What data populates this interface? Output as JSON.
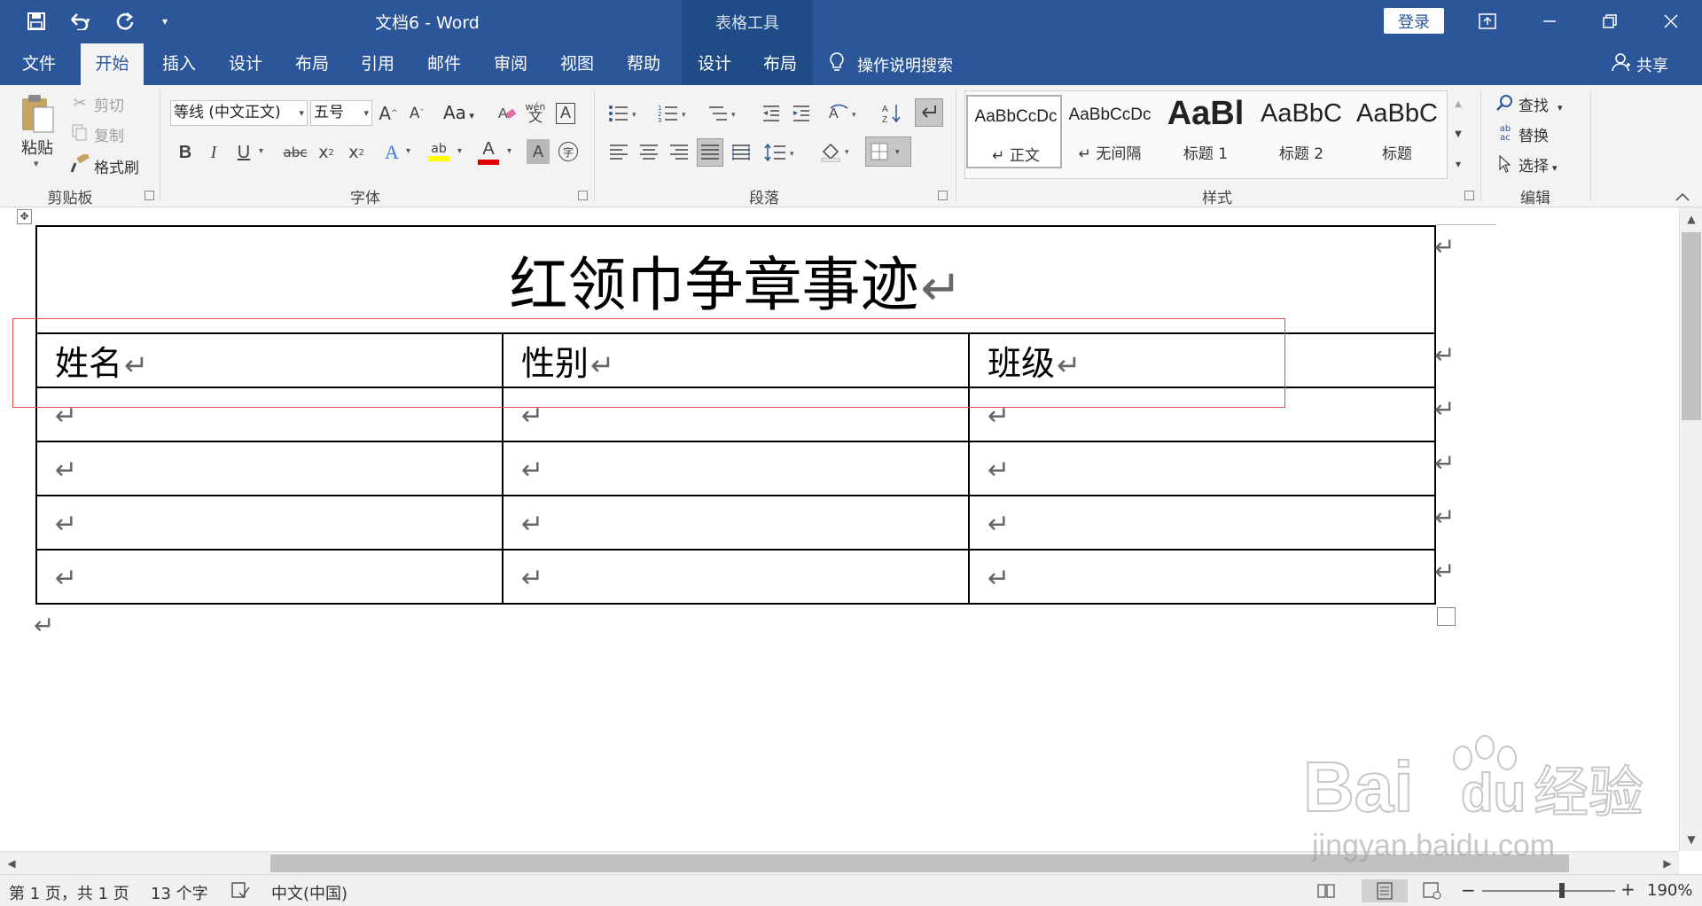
{
  "titlebar": {
    "doc_title": "文档6  -  Word",
    "context_label": "表格工具",
    "login_label": "登录",
    "quick_access": [
      "save-icon",
      "undo-icon",
      "redo-icon",
      "customize-icon"
    ]
  },
  "tabs": [
    {
      "label": "文件"
    },
    {
      "label": "开始"
    },
    {
      "label": "插入"
    },
    {
      "label": "设计"
    },
    {
      "label": "布局"
    },
    {
      "label": "引用"
    },
    {
      "label": "邮件"
    },
    {
      "label": "审阅"
    },
    {
      "label": "视图"
    },
    {
      "label": "帮助"
    },
    {
      "label": "设计"
    },
    {
      "label": "布局"
    }
  ],
  "tellme": {
    "label": "操作说明搜索"
  },
  "share": {
    "label": "共享"
  },
  "ribbon": {
    "clipboard": {
      "paste": "粘贴",
      "cut": "剪切",
      "copy": "复制",
      "painter": "格式刷",
      "label": "剪贴板"
    },
    "font": {
      "name": "等线 (中文正文)",
      "size": "五号",
      "case": "Aa",
      "label": "字体",
      "bold": "B",
      "italic": "I",
      "underline": "U",
      "strike": "abc",
      "sub": "x",
      "sup": "x",
      "phonetic": "wén",
      "highlight": "ab",
      "char_shade": "A",
      "enclose": "字"
    },
    "paragraph": {
      "label": "段落"
    },
    "styles": {
      "label": "样式",
      "items": [
        {
          "sample": "AaBbCcDc",
          "name": "↵ 正文"
        },
        {
          "sample": "AaBbCcDc",
          "name": "↵ 无间隔"
        },
        {
          "sample": "AaBl",
          "name": "标题 1"
        },
        {
          "sample": "AaBbC",
          "name": "标题 2"
        },
        {
          "sample": "AaBbC",
          "name": "标题"
        }
      ]
    },
    "editing": {
      "find": "查找",
      "replace": "替换",
      "select": "选择",
      "label": "编辑"
    }
  },
  "document": {
    "table_title": "红领巾争章事迹",
    "headers": [
      "姓名",
      "性别",
      "班级"
    ],
    "return_mark": "↵"
  },
  "statusbar": {
    "page": "第 1 页，共 1 页",
    "words": "13 个字",
    "language": "中文(中国)",
    "zoom": "190%"
  },
  "watermark": {
    "brand": "Bai",
    "brand2": "du",
    "cn": "经验",
    "url": "jingyan.baidu.com"
  },
  "colors": {
    "accent": "#2b579a",
    "context_tab": "#1f4b86",
    "highlight_box": "#e04b4b"
  }
}
